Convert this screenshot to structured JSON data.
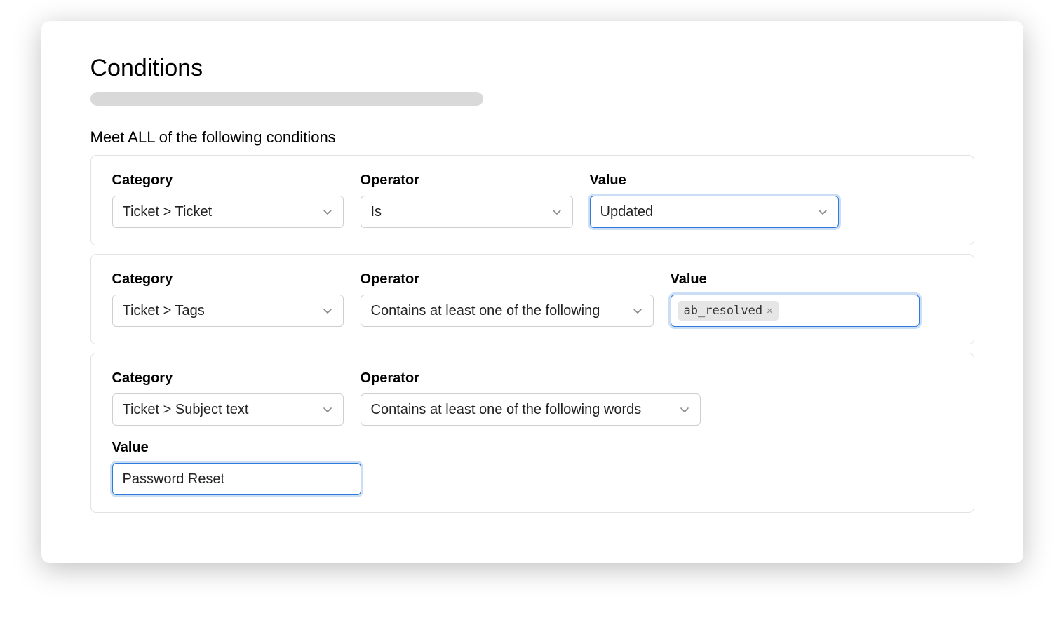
{
  "header": {
    "title": "Conditions",
    "subtitle": "Meet ALL of the following conditions"
  },
  "labels": {
    "category": "Category",
    "operator": "Operator",
    "value": "Value"
  },
  "conditions": [
    {
      "category": "Ticket > Ticket",
      "operator": "Is",
      "value": "Updated",
      "value_type": "select",
      "value_focused": true,
      "operator_width": "w-op-s"
    },
    {
      "category": "Ticket > Tags",
      "operator": "Contains at least one of the following",
      "value_tags": [
        "ab_resolved"
      ],
      "value_type": "tags",
      "value_focused": true,
      "operator_width": "w-op-m"
    },
    {
      "category": "Ticket > Subject text",
      "operator": "Contains at least one of the following words",
      "value": "Password Reset",
      "value_type": "text",
      "value_focused": true,
      "value_below": true,
      "operator_width": "w-op-l"
    }
  ]
}
